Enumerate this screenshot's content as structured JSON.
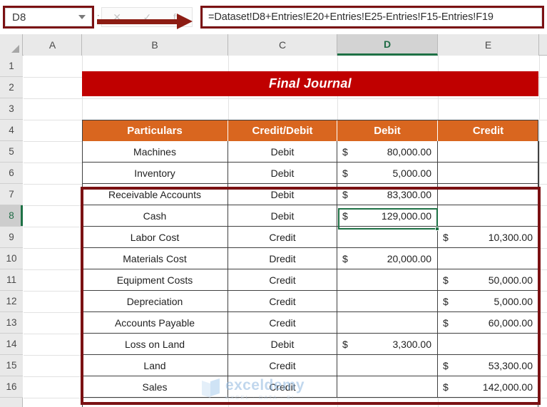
{
  "formula_bar": {
    "name_box_value": "D8",
    "name_box_caret_icon": "chevron-down-icon",
    "cancel_icon": "cancel-x-icon",
    "enter_icon": "enter-check-icon",
    "insert_function_icon": "fx-icon",
    "cancel_label": "✕",
    "enter_label": "✓",
    "fx_label": "fx",
    "separator_label": ":",
    "formula": "=Dataset!D8+Entries!E20+Entries!E25-Entries!F15-Entries!F19",
    "annotation_arrow_icon": "red-arrow-icon"
  },
  "grid": {
    "select_all_icon": "select-all-corner-icon",
    "columns": [
      "A",
      "B",
      "C",
      "D",
      "E"
    ],
    "selected_column": "D",
    "rows": [
      "1",
      "2",
      "3",
      "4",
      "5",
      "6",
      "7",
      "8",
      "9",
      "10",
      "11",
      "12",
      "13",
      "14",
      "15",
      "16"
    ],
    "selected_row": "8",
    "active_cell": "D8"
  },
  "sheet": {
    "title": "Final Journal",
    "headers": [
      "Particulars",
      "Credit/Debit",
      "Debit",
      "Credit"
    ],
    "currency_symbol": "$",
    "rows": [
      {
        "particulars": "Machines",
        "type": "Debit",
        "debit": "80,000.00",
        "credit": ""
      },
      {
        "particulars": "Inventory",
        "type": "Debit",
        "debit": "5,000.00",
        "credit": ""
      },
      {
        "particulars": "Receivable Accounts",
        "type": "Debit",
        "debit": "83,300.00",
        "credit": ""
      },
      {
        "particulars": "Cash",
        "type": "Debit",
        "debit": "129,000.00",
        "credit": ""
      },
      {
        "particulars": "Labor Cost",
        "type": "Credit",
        "debit": "",
        "credit": "10,300.00"
      },
      {
        "particulars": "Materials Cost",
        "type": "Dredit",
        "debit": "20,000.00",
        "credit": ""
      },
      {
        "particulars": "Equipment Costs",
        "type": "Credit",
        "debit": "",
        "credit": "50,000.00"
      },
      {
        "particulars": "Depreciation",
        "type": "Credit",
        "debit": "",
        "credit": "5,000.00"
      },
      {
        "particulars": "Accounts Payable",
        "type": "Credit",
        "debit": "",
        "credit": "60,000.00"
      },
      {
        "particulars": "Loss on Land",
        "type": "Debit",
        "debit": "3,300.00",
        "credit": ""
      },
      {
        "particulars": "Land",
        "type": "Credit",
        "debit": "",
        "credit": "53,300.00"
      },
      {
        "particulars": "Sales",
        "type": "Credit",
        "debit": "",
        "credit": "142,000.00"
      }
    ]
  },
  "watermark": {
    "name": "exceldemy",
    "tagline": "EXCEL · DATA · BI",
    "logo_icon": "exceldemy-cube-icon"
  },
  "colors": {
    "title_red": "#c00000",
    "header_orange": "#d9661f",
    "annotation_dark_red": "#7b1113",
    "arrow_red": "#8c1c13",
    "selection_green": "#1e7145"
  }
}
